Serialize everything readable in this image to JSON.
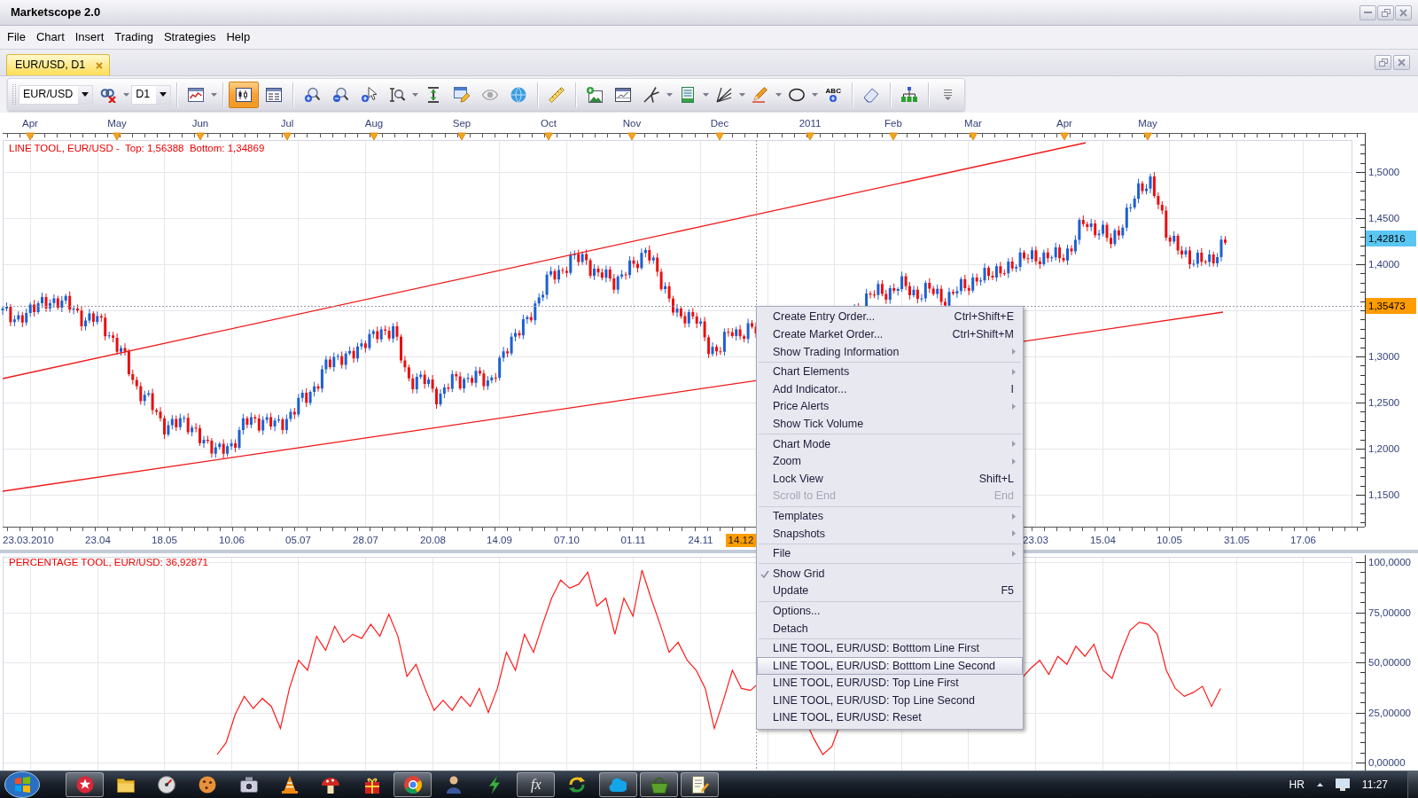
{
  "window": {
    "title": "Marketscope 2.0"
  },
  "menu": [
    "File",
    "Chart",
    "Insert",
    "Trading",
    "Strategies",
    "Help"
  ],
  "tabs": [
    {
      "label": "EUR/USD, D1",
      "selected": true
    }
  ],
  "toolbar": {
    "items": [
      {
        "kind": "combo",
        "value": "EUR/USD"
      },
      {
        "kind": "button",
        "selected": false,
        "dropdown": true
      },
      {
        "kind": "combo",
        "value": "D1"
      },
      {
        "kind": "separator"
      },
      {
        "kind": "button",
        "selected": false,
        "dropdown": true
      },
      {
        "kind": "separator"
      },
      {
        "kind": "button",
        "selected": true,
        "dropdown": false
      },
      {
        "kind": "button",
        "selected": false,
        "dropdown": false
      },
      {
        "kind": "separator"
      },
      {
        "kind": "button",
        "selected": false,
        "dropdown": false
      },
      {
        "kind": "button",
        "selected": false,
        "dropdown": false
      },
      {
        "kind": "button",
        "selected": false,
        "dropdown": false
      },
      {
        "kind": "button",
        "selected": false,
        "dropdown": true
      },
      {
        "kind": "button",
        "selected": false,
        "dropdown": false
      },
      {
        "kind": "button",
        "selected": false,
        "dropdown": false
      },
      {
        "kind": "button",
        "selected": false,
        "dropdown": false
      },
      {
        "kind": "button",
        "selected": false,
        "dropdown": false
      },
      {
        "kind": "separator"
      },
      {
        "kind": "button",
        "selected": false,
        "dropdown": false
      },
      {
        "kind": "separator"
      },
      {
        "kind": "button",
        "selected": false,
        "dropdown": false
      },
      {
        "kind": "button",
        "selected": false,
        "dropdown": false
      },
      {
        "kind": "button",
        "selected": false,
        "dropdown": true
      },
      {
        "kind": "button",
        "selected": false,
        "dropdown": true
      },
      {
        "kind": "button",
        "selected": false,
        "dropdown": true
      },
      {
        "kind": "button",
        "selected": false,
        "dropdown": true
      },
      {
        "kind": "button",
        "selected": false,
        "dropdown": true
      },
      {
        "kind": "button",
        "selected": false,
        "dropdown": false,
        "label": "ABC"
      },
      {
        "kind": "separator"
      },
      {
        "kind": "button",
        "selected": false,
        "dropdown": false
      },
      {
        "kind": "separator"
      },
      {
        "kind": "button",
        "selected": false,
        "dropdown": false
      },
      {
        "kind": "separator"
      },
      {
        "kind": "button",
        "selected": false,
        "dropdown": false
      }
    ]
  },
  "price_chart": {
    "months": [
      "Apr",
      "May",
      "Jun",
      "Jul",
      "Aug",
      "Sep",
      "Oct",
      "Nov",
      "Dec",
      "2011",
      "Feb",
      "Mar",
      "Apr",
      "May"
    ],
    "legend": "LINE TOOL, EUR/USD -  Top: 1,56388  Bottom: 1,34869",
    "price_labels": [
      "1,5000",
      "1,4500",
      "1,4000",
      "1,3000",
      "1,2500",
      "1,2000",
      "1,1500"
    ],
    "last_price": "1,42816",
    "cursor_price": "1,35473",
    "dates": [
      {
        "label": "23.03.2010",
        "selected": false
      },
      {
        "label": "23.04",
        "selected": false
      },
      {
        "label": "18.05",
        "selected": false
      },
      {
        "label": "10.06",
        "selected": false
      },
      {
        "label": "05.07",
        "selected": false
      },
      {
        "label": "28.07",
        "selected": false
      },
      {
        "label": "20.08",
        "selected": false
      },
      {
        "label": "14.09",
        "selected": false
      },
      {
        "label": "07.10",
        "selected": false
      },
      {
        "label": "01.11",
        "selected": false
      },
      {
        "label": "24.11",
        "selected": false
      },
      {
        "label": "14.12",
        "selected": true
      },
      {
        "label": "23.03",
        "selected": false
      },
      {
        "label": "15.04",
        "selected": false
      },
      {
        "label": "10.05",
        "selected": false
      },
      {
        "label": "31.05",
        "selected": false
      },
      {
        "label": "17.06",
        "selected": false
      }
    ]
  },
  "indicator_chart": {
    "title": "PERCENTAGE TOOL, EUR/USD: 36,92871",
    "axis_labels": [
      "100,0000",
      "75,00000",
      "50,00000",
      "25,00000",
      "0,00000"
    ]
  },
  "context_menu": {
    "groups": [
      [
        {
          "label": "Create Entry Order...",
          "shortcut": "Ctrl+Shift+E",
          "submenu": false,
          "checked": false,
          "disabled": false,
          "selected": false
        },
        {
          "label": "Create Market Order...",
          "shortcut": "Ctrl+Shift+M",
          "submenu": false,
          "checked": false,
          "disabled": false,
          "selected": false
        },
        {
          "label": "Show Trading Information",
          "submenu": true,
          "checked": false,
          "disabled": false,
          "selected": false
        }
      ],
      [
        {
          "label": "Chart Elements",
          "submenu": true,
          "checked": false,
          "disabled": false,
          "selected": false
        },
        {
          "label": "Add Indicator...",
          "shortcut": "I",
          "submenu": false,
          "checked": false,
          "disabled": false,
          "selected": false
        },
        {
          "label": "Price Alerts",
          "submenu": true,
          "checked": false,
          "disabled": false,
          "selected": false
        },
        {
          "label": "Show Tick Volume",
          "submenu": false,
          "checked": false,
          "disabled": false,
          "selected": false
        }
      ],
      [
        {
          "label": "Chart Mode",
          "submenu": true,
          "checked": false,
          "disabled": false,
          "selected": false
        },
        {
          "label": "Zoom",
          "submenu": true,
          "checked": false,
          "disabled": false,
          "selected": false
        },
        {
          "label": "Lock View",
          "shortcut": "Shift+L",
          "submenu": false,
          "checked": false,
          "disabled": false,
          "selected": false
        },
        {
          "label": "Scroll to End",
          "shortcut": "End",
          "submenu": false,
          "checked": false,
          "disabled": true,
          "selected": false
        }
      ],
      [
        {
          "label": "Templates",
          "submenu": true,
          "checked": false,
          "disabled": false,
          "selected": false
        },
        {
          "label": "Snapshots",
          "submenu": true,
          "checked": false,
          "disabled": false,
          "selected": false
        }
      ],
      [
        {
          "label": "File",
          "submenu": true,
          "checked": false,
          "disabled": false,
          "selected": false
        }
      ],
      [
        {
          "label": "Show Grid",
          "submenu": false,
          "checked": true,
          "disabled": false,
          "selected": false
        },
        {
          "label": "Update",
          "shortcut": "F5",
          "submenu": false,
          "checked": false,
          "disabled": false,
          "selected": false
        }
      ],
      [
        {
          "label": "Options...",
          "submenu": false,
          "checked": false,
          "disabled": false,
          "selected": false
        },
        {
          "label": "Detach",
          "submenu": false,
          "checked": false,
          "disabled": false,
          "selected": false
        }
      ],
      [
        {
          "label": "LINE TOOL, EUR/USD: Botttom Line First",
          "submenu": false,
          "checked": false,
          "disabled": false,
          "selected": false
        },
        {
          "label": "LINE TOOL, EUR/USD: Botttom Line Second",
          "submenu": false,
          "checked": false,
          "disabled": false,
          "selected": true
        },
        {
          "label": "LINE TOOL, EUR/USD: Top Line First",
          "submenu": false,
          "checked": false,
          "disabled": false,
          "selected": false
        },
        {
          "label": "LINE TOOL, EUR/USD: Top Line Second",
          "submenu": false,
          "checked": false,
          "disabled": false,
          "selected": false
        },
        {
          "label": "LINE TOOL, EUR/USD: Reset",
          "submenu": false,
          "checked": false,
          "disabled": false,
          "selected": false
        }
      ]
    ]
  },
  "taskbar": {
    "apps": [
      {
        "running": true
      },
      {
        "running": false
      },
      {
        "running": false
      },
      {
        "running": false
      },
      {
        "running": false
      },
      {
        "running": false
      },
      {
        "running": false
      },
      {
        "running": false
      },
      {
        "running": true
      },
      {
        "running": false
      },
      {
        "running": false
      },
      {
        "running": true,
        "label": "fx"
      },
      {
        "running": false
      },
      {
        "running": true
      },
      {
        "running": true
      },
      {
        "running": true
      }
    ],
    "language": "HR",
    "clock": "11:27"
  }
}
